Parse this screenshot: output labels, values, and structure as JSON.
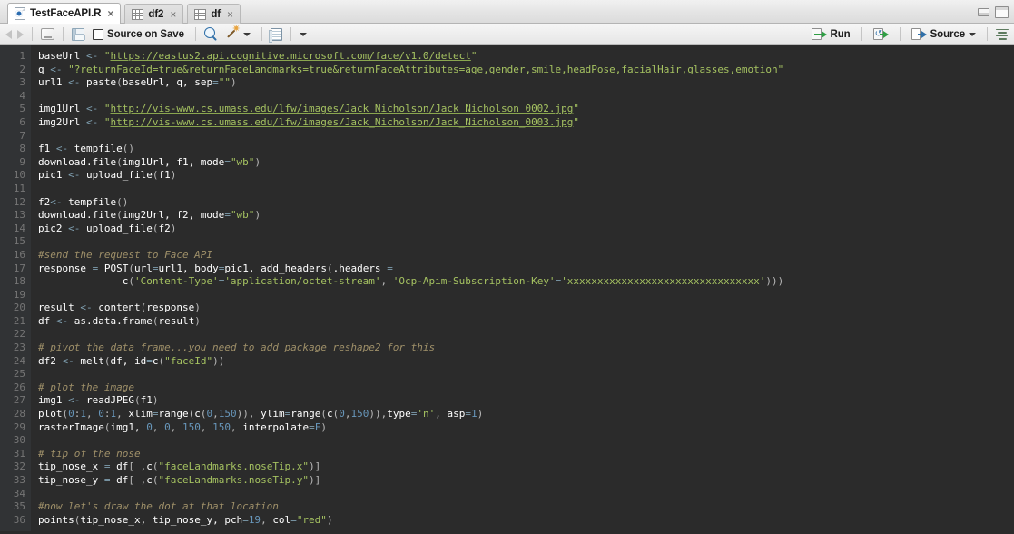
{
  "window": {
    "minimize_label": "minimize",
    "maximize_label": "maximize"
  },
  "tabs": [
    {
      "label": "TestFaceAPI.R",
      "icon": "r-file-icon",
      "close": "×",
      "active": true
    },
    {
      "label": "df2",
      "icon": "grid-icon",
      "close": "×",
      "active": false
    },
    {
      "label": "df",
      "icon": "grid-icon",
      "close": "×",
      "active": false
    }
  ],
  "toolbar": {
    "back_icon": "back-arrow-icon",
    "forward_icon": "forward-arrow-icon",
    "show_in_new_window_icon": "show-in-new-window-icon",
    "save_icon": "save-icon",
    "source_on_save_label": "Source on Save",
    "find_icon": "search-icon",
    "code_tools_icon": "magic-wand-icon",
    "code_tools_caret": "▾",
    "compile_report_icon": "compile-report-icon",
    "compile_report_caret": "▾",
    "run_label": "Run",
    "run_icon": "run-icon",
    "rerun_icon": "rerun-icon",
    "source_label": "Source",
    "source_icon": "source-icon",
    "source_caret": "▾",
    "outline_icon": "document-outline-icon"
  },
  "editor": {
    "theme_background": "#2b2b2b",
    "gutter_background": "#313335",
    "line_number_color": "#757575",
    "string_color": "#a5c261",
    "comment_color": "#9f9069",
    "number_color": "#6897bb",
    "operator_color": "#7f9fb0",
    "first_line": 1,
    "last_line": 36,
    "lines": [
      {
        "n": 1,
        "tokens": [
          {
            "t": "baseUrl ",
            "c": "k-var"
          },
          {
            "t": "<- ",
            "c": "k-op"
          },
          {
            "t": "\"",
            "c": "k-str"
          },
          {
            "t": "https://eastus2.api.cognitive.microsoft.com/face/v1.0/detect",
            "c": "k-url"
          },
          {
            "t": "\"",
            "c": "k-str"
          }
        ]
      },
      {
        "n": 2,
        "tokens": [
          {
            "t": "q ",
            "c": "k-var"
          },
          {
            "t": "<- ",
            "c": "k-op"
          },
          {
            "t": "\"?returnFaceId=true&returnFaceLandmarks=true&returnFaceAttributes=age,gender,smile,headPose,facialHair,glasses,emotion\"",
            "c": "k-str"
          }
        ]
      },
      {
        "n": 3,
        "tokens": [
          {
            "t": "url1 ",
            "c": "k-var"
          },
          {
            "t": "<- ",
            "c": "k-op"
          },
          {
            "t": "paste",
            "c": "k-fn"
          },
          {
            "t": "(",
            "c": "k-punc"
          },
          {
            "t": "baseUrl, q, sep",
            "c": "k-var"
          },
          {
            "t": "=",
            "c": "k-op"
          },
          {
            "t": "\"\"",
            "c": "k-str"
          },
          {
            "t": ")",
            "c": "k-punc"
          }
        ]
      },
      {
        "n": 4,
        "tokens": []
      },
      {
        "n": 5,
        "tokens": [
          {
            "t": "img1Url ",
            "c": "k-var"
          },
          {
            "t": "<- ",
            "c": "k-op"
          },
          {
            "t": "\"",
            "c": "k-str"
          },
          {
            "t": "http://vis-www.cs.umass.edu/lfw/images/Jack_Nicholson/Jack_Nicholson_0002.jpg",
            "c": "k-url"
          },
          {
            "t": "\"",
            "c": "k-str"
          }
        ]
      },
      {
        "n": 6,
        "tokens": [
          {
            "t": "img2Url ",
            "c": "k-var"
          },
          {
            "t": "<- ",
            "c": "k-op"
          },
          {
            "t": "\"",
            "c": "k-str"
          },
          {
            "t": "http://vis-www.cs.umass.edu/lfw/images/Jack_Nicholson/Jack_Nicholson_0003.jpg",
            "c": "k-url"
          },
          {
            "t": "\"",
            "c": "k-str"
          }
        ]
      },
      {
        "n": 7,
        "tokens": []
      },
      {
        "n": 8,
        "tokens": [
          {
            "t": "f1 ",
            "c": "k-var"
          },
          {
            "t": "<- ",
            "c": "k-op"
          },
          {
            "t": "tempfile",
            "c": "k-fn"
          },
          {
            "t": "()",
            "c": "k-punc"
          }
        ]
      },
      {
        "n": 9,
        "tokens": [
          {
            "t": "download.file",
            "c": "k-fn"
          },
          {
            "t": "(",
            "c": "k-punc"
          },
          {
            "t": "img1Url, f1, mode",
            "c": "k-var"
          },
          {
            "t": "=",
            "c": "k-op"
          },
          {
            "t": "\"wb\"",
            "c": "k-str"
          },
          {
            "t": ")",
            "c": "k-punc"
          }
        ]
      },
      {
        "n": 10,
        "tokens": [
          {
            "t": "pic1 ",
            "c": "k-var"
          },
          {
            "t": "<- ",
            "c": "k-op"
          },
          {
            "t": "upload_file",
            "c": "k-fn"
          },
          {
            "t": "(",
            "c": "k-punc"
          },
          {
            "t": "f1",
            "c": "k-var"
          },
          {
            "t": ")",
            "c": "k-punc"
          }
        ]
      },
      {
        "n": 11,
        "tokens": []
      },
      {
        "n": 12,
        "tokens": [
          {
            "t": "f2",
            "c": "k-var"
          },
          {
            "t": "<- ",
            "c": "k-op"
          },
          {
            "t": "tempfile",
            "c": "k-fn"
          },
          {
            "t": "()",
            "c": "k-punc"
          }
        ]
      },
      {
        "n": 13,
        "tokens": [
          {
            "t": "download.file",
            "c": "k-fn"
          },
          {
            "t": "(",
            "c": "k-punc"
          },
          {
            "t": "img2Url, f2, mode",
            "c": "k-var"
          },
          {
            "t": "=",
            "c": "k-op"
          },
          {
            "t": "\"wb\"",
            "c": "k-str"
          },
          {
            "t": ")",
            "c": "k-punc"
          }
        ]
      },
      {
        "n": 14,
        "tokens": [
          {
            "t": "pic2 ",
            "c": "k-var"
          },
          {
            "t": "<- ",
            "c": "k-op"
          },
          {
            "t": "upload_file",
            "c": "k-fn"
          },
          {
            "t": "(",
            "c": "k-punc"
          },
          {
            "t": "f2",
            "c": "k-var"
          },
          {
            "t": ")",
            "c": "k-punc"
          }
        ]
      },
      {
        "n": 15,
        "tokens": []
      },
      {
        "n": 16,
        "tokens": [
          {
            "t": "#send the request to Face API",
            "c": "k-cmt"
          }
        ]
      },
      {
        "n": 17,
        "tokens": [
          {
            "t": "response ",
            "c": "k-var"
          },
          {
            "t": "= ",
            "c": "k-op"
          },
          {
            "t": "POST",
            "c": "k-fn"
          },
          {
            "t": "(",
            "c": "k-punc"
          },
          {
            "t": "url",
            "c": "k-var"
          },
          {
            "t": "=",
            "c": "k-op"
          },
          {
            "t": "url1, body",
            "c": "k-var"
          },
          {
            "t": "=",
            "c": "k-op"
          },
          {
            "t": "pic1, ",
            "c": "k-var"
          },
          {
            "t": "add_headers",
            "c": "k-fn"
          },
          {
            "t": "(",
            "c": "k-punc"
          },
          {
            "t": ".headers ",
            "c": "k-var"
          },
          {
            "t": "=",
            "c": "k-op"
          }
        ]
      },
      {
        "n": 18,
        "tokens": [
          {
            "t": "              ",
            "c": "k-var"
          },
          {
            "t": "c",
            "c": "k-fn"
          },
          {
            "t": "(",
            "c": "k-punc"
          },
          {
            "t": "'Content-Type'",
            "c": "k-str"
          },
          {
            "t": "=",
            "c": "k-op"
          },
          {
            "t": "'application/octet-stream'",
            "c": "k-str"
          },
          {
            "t": ", ",
            "c": "k-punc"
          },
          {
            "t": "'Ocp-Apim-Subscription-Key'",
            "c": "k-str"
          },
          {
            "t": "=",
            "c": "k-op"
          },
          {
            "t": "'xxxxxxxxxxxxxxxxxxxxxxxxxxxxxxxx'",
            "c": "k-str"
          },
          {
            "t": ")))",
            "c": "k-punc"
          }
        ]
      },
      {
        "n": 19,
        "tokens": []
      },
      {
        "n": 20,
        "tokens": [
          {
            "t": "result ",
            "c": "k-var"
          },
          {
            "t": "<- ",
            "c": "k-op"
          },
          {
            "t": "content",
            "c": "k-fn"
          },
          {
            "t": "(",
            "c": "k-punc"
          },
          {
            "t": "response",
            "c": "k-var"
          },
          {
            "t": ")",
            "c": "k-punc"
          }
        ]
      },
      {
        "n": 21,
        "tokens": [
          {
            "t": "df ",
            "c": "k-var"
          },
          {
            "t": "<- ",
            "c": "k-op"
          },
          {
            "t": "as.data.frame",
            "c": "k-fn"
          },
          {
            "t": "(",
            "c": "k-punc"
          },
          {
            "t": "result",
            "c": "k-var"
          },
          {
            "t": ")",
            "c": "k-punc"
          }
        ]
      },
      {
        "n": 22,
        "tokens": []
      },
      {
        "n": 23,
        "tokens": [
          {
            "t": "# pivot the data frame...you need to add package reshape2 for this",
            "c": "k-cmt"
          }
        ]
      },
      {
        "n": 24,
        "tokens": [
          {
            "t": "df2 ",
            "c": "k-var"
          },
          {
            "t": "<- ",
            "c": "k-op"
          },
          {
            "t": "melt",
            "c": "k-fn"
          },
          {
            "t": "(",
            "c": "k-punc"
          },
          {
            "t": "df, id",
            "c": "k-var"
          },
          {
            "t": "=",
            "c": "k-op"
          },
          {
            "t": "c",
            "c": "k-fn"
          },
          {
            "t": "(",
            "c": "k-punc"
          },
          {
            "t": "\"faceId\"",
            "c": "k-str"
          },
          {
            "t": "))",
            "c": "k-punc"
          }
        ]
      },
      {
        "n": 25,
        "tokens": []
      },
      {
        "n": 26,
        "tokens": [
          {
            "t": "# plot the image",
            "c": "k-cmt"
          }
        ]
      },
      {
        "n": 27,
        "tokens": [
          {
            "t": "img1 ",
            "c": "k-var"
          },
          {
            "t": "<- ",
            "c": "k-op"
          },
          {
            "t": "readJPEG",
            "c": "k-fn"
          },
          {
            "t": "(",
            "c": "k-punc"
          },
          {
            "t": "f1",
            "c": "k-var"
          },
          {
            "t": ")",
            "c": "k-punc"
          }
        ]
      },
      {
        "n": 28,
        "tokens": [
          {
            "t": "plot",
            "c": "k-fn"
          },
          {
            "t": "(",
            "c": "k-punc"
          },
          {
            "t": "0",
            "c": "k-num"
          },
          {
            "t": ":",
            "c": "k-punc"
          },
          {
            "t": "1",
            "c": "k-num"
          },
          {
            "t": ", ",
            "c": "k-punc"
          },
          {
            "t": "0",
            "c": "k-num"
          },
          {
            "t": ":",
            "c": "k-punc"
          },
          {
            "t": "1",
            "c": "k-num"
          },
          {
            "t": ", ",
            "c": "k-punc"
          },
          {
            "t": "xlim",
            "c": "k-var"
          },
          {
            "t": "=",
            "c": "k-op"
          },
          {
            "t": "range",
            "c": "k-fn"
          },
          {
            "t": "(",
            "c": "k-punc"
          },
          {
            "t": "c",
            "c": "k-fn"
          },
          {
            "t": "(",
            "c": "k-punc"
          },
          {
            "t": "0",
            "c": "k-num"
          },
          {
            "t": ",",
            "c": "k-punc"
          },
          {
            "t": "150",
            "c": "k-num"
          },
          {
            "t": ")), ",
            "c": "k-punc"
          },
          {
            "t": "ylim",
            "c": "k-var"
          },
          {
            "t": "=",
            "c": "k-op"
          },
          {
            "t": "range",
            "c": "k-fn"
          },
          {
            "t": "(",
            "c": "k-punc"
          },
          {
            "t": "c",
            "c": "k-fn"
          },
          {
            "t": "(",
            "c": "k-punc"
          },
          {
            "t": "0",
            "c": "k-num"
          },
          {
            "t": ",",
            "c": "k-punc"
          },
          {
            "t": "150",
            "c": "k-num"
          },
          {
            "t": ")),",
            "c": "k-punc"
          },
          {
            "t": "type",
            "c": "k-var"
          },
          {
            "t": "=",
            "c": "k-op"
          },
          {
            "t": "'n'",
            "c": "k-str"
          },
          {
            "t": ", ",
            "c": "k-punc"
          },
          {
            "t": "asp",
            "c": "k-var"
          },
          {
            "t": "=",
            "c": "k-op"
          },
          {
            "t": "1",
            "c": "k-num"
          },
          {
            "t": ")",
            "c": "k-punc"
          }
        ]
      },
      {
        "n": 29,
        "tokens": [
          {
            "t": "rasterImage",
            "c": "k-fn"
          },
          {
            "t": "(",
            "c": "k-punc"
          },
          {
            "t": "img1, ",
            "c": "k-var"
          },
          {
            "t": "0",
            "c": "k-num"
          },
          {
            "t": ", ",
            "c": "k-punc"
          },
          {
            "t": "0",
            "c": "k-num"
          },
          {
            "t": ", ",
            "c": "k-punc"
          },
          {
            "t": "150",
            "c": "k-num"
          },
          {
            "t": ", ",
            "c": "k-punc"
          },
          {
            "t": "150",
            "c": "k-num"
          },
          {
            "t": ", ",
            "c": "k-punc"
          },
          {
            "t": "interpolate",
            "c": "k-var"
          },
          {
            "t": "=",
            "c": "k-op"
          },
          {
            "t": "F",
            "c": "k-num"
          },
          {
            "t": ")",
            "c": "k-punc"
          }
        ]
      },
      {
        "n": 30,
        "tokens": []
      },
      {
        "n": 31,
        "tokens": [
          {
            "t": "# tip of the nose",
            "c": "k-cmt"
          }
        ]
      },
      {
        "n": 32,
        "tokens": [
          {
            "t": "tip_nose_x ",
            "c": "k-var"
          },
          {
            "t": "= ",
            "c": "k-op"
          },
          {
            "t": "df",
            "c": "k-var"
          },
          {
            "t": "[ ,",
            "c": "k-punc"
          },
          {
            "t": "c",
            "c": "k-fn"
          },
          {
            "t": "(",
            "c": "k-punc"
          },
          {
            "t": "\"faceLandmarks.noseTip.x\"",
            "c": "k-str"
          },
          {
            "t": ")]",
            "c": "k-punc"
          }
        ]
      },
      {
        "n": 33,
        "tokens": [
          {
            "t": "tip_nose_y ",
            "c": "k-var"
          },
          {
            "t": "= ",
            "c": "k-op"
          },
          {
            "t": "df",
            "c": "k-var"
          },
          {
            "t": "[ ,",
            "c": "k-punc"
          },
          {
            "t": "c",
            "c": "k-fn"
          },
          {
            "t": "(",
            "c": "k-punc"
          },
          {
            "t": "\"faceLandmarks.noseTip.y\"",
            "c": "k-str"
          },
          {
            "t": ")]",
            "c": "k-punc"
          }
        ]
      },
      {
        "n": 34,
        "tokens": []
      },
      {
        "n": 35,
        "tokens": [
          {
            "t": "#now let's draw the dot at that location",
            "c": "k-cmt"
          }
        ]
      },
      {
        "n": 36,
        "tokens": [
          {
            "t": "points",
            "c": "k-fn"
          },
          {
            "t": "(",
            "c": "k-punc"
          },
          {
            "t": "tip_nose_x, tip_nose_y, pch",
            "c": "k-var"
          },
          {
            "t": "=",
            "c": "k-op"
          },
          {
            "t": "19",
            "c": "k-num"
          },
          {
            "t": ", ",
            "c": "k-punc"
          },
          {
            "t": "col",
            "c": "k-var"
          },
          {
            "t": "=",
            "c": "k-op"
          },
          {
            "t": "\"red\"",
            "c": "k-str"
          },
          {
            "t": ")",
            "c": "k-punc"
          }
        ]
      }
    ]
  }
}
